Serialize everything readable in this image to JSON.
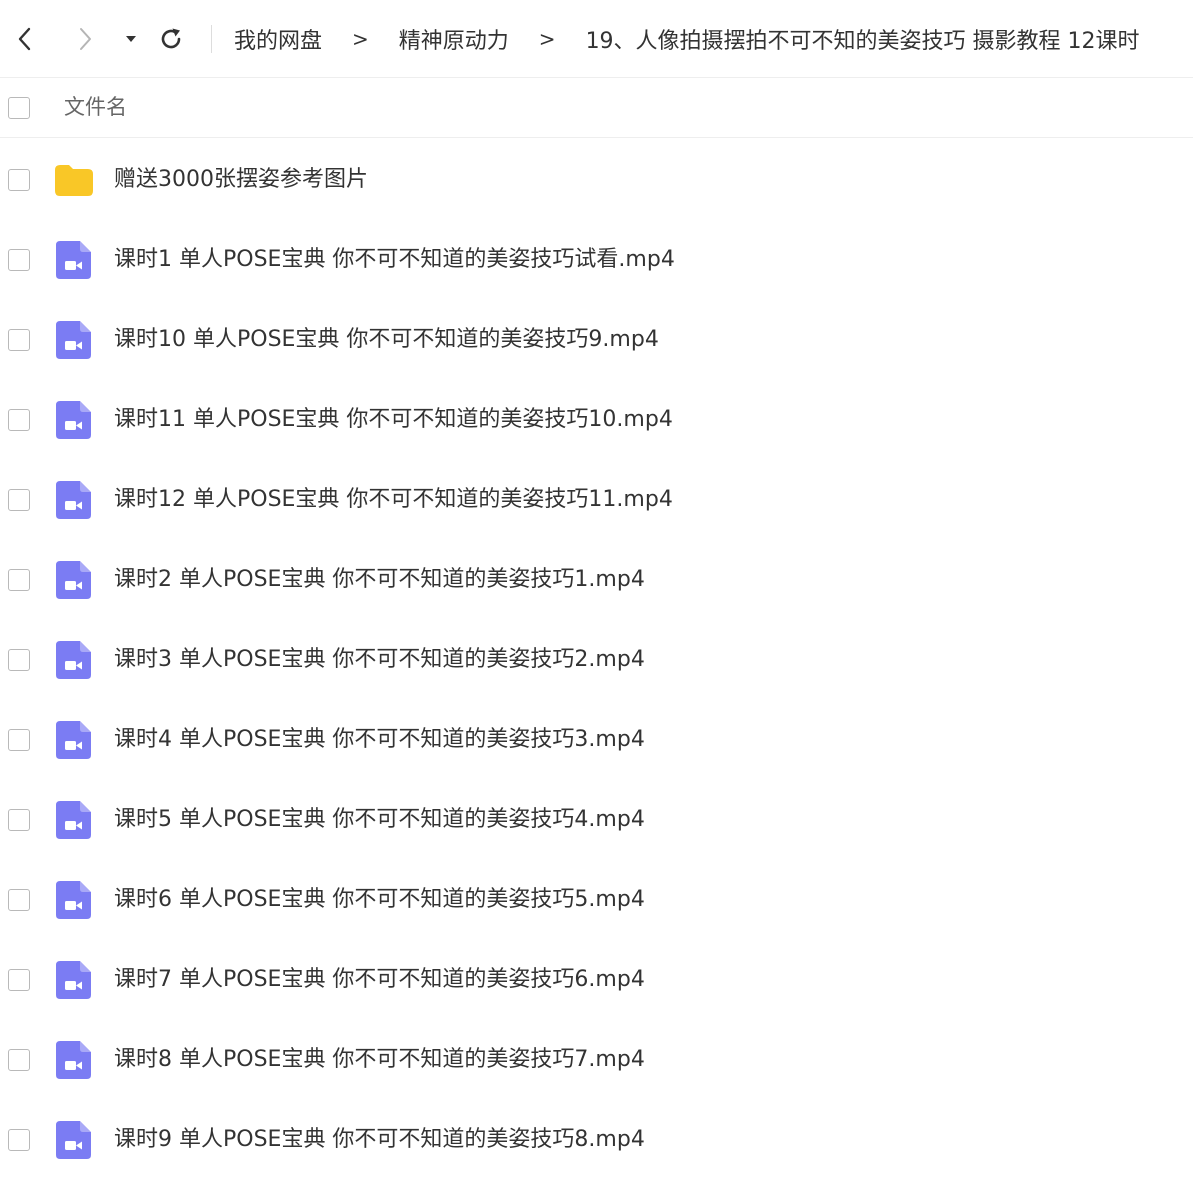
{
  "toolbar": {
    "back_icon": "chevron-left-icon",
    "forward_icon": "chevron-right-icon",
    "dropdown_icon": "caret-down-icon",
    "refresh_icon": "refresh-icon"
  },
  "breadcrumb": {
    "items": [
      "我的网盘",
      "精神原动力",
      "19、人像拍摄摆拍不可不知的美姿技巧 摄影教程 12课时"
    ],
    "separator": ">"
  },
  "header": {
    "column_name": "文件名"
  },
  "colors": {
    "folder": "#F9C727",
    "video": "#7B7CF3",
    "text": "#333333",
    "border": "#EEEEEE"
  },
  "files": [
    {
      "name": "赠送3000张摆姿参考图片",
      "type": "folder"
    },
    {
      "name": "课时1 单人POSE宝典 你不可不知道的美姿技巧试看.mp4",
      "type": "video"
    },
    {
      "name": "课时10 单人POSE宝典 你不可不知道的美姿技巧9.mp4",
      "type": "video"
    },
    {
      "name": "课时11 单人POSE宝典 你不可不知道的美姿技巧10.mp4",
      "type": "video"
    },
    {
      "name": "课时12 单人POSE宝典 你不可不知道的美姿技巧11.mp4",
      "type": "video"
    },
    {
      "name": "课时2 单人POSE宝典 你不可不知道的美姿技巧1.mp4",
      "type": "video"
    },
    {
      "name": "课时3 单人POSE宝典 你不可不知道的美姿技巧2.mp4",
      "type": "video"
    },
    {
      "name": "课时4 单人POSE宝典 你不可不知道的美姿技巧3.mp4",
      "type": "video"
    },
    {
      "name": "课时5 单人POSE宝典 你不可不知道的美姿技巧4.mp4",
      "type": "video"
    },
    {
      "name": "课时6 单人POSE宝典 你不可不知道的美姿技巧5.mp4",
      "type": "video"
    },
    {
      "name": "课时7 单人POSE宝典 你不可不知道的美姿技巧6.mp4",
      "type": "video"
    },
    {
      "name": "课时8 单人POSE宝典 你不可不知道的美姿技巧7.mp4",
      "type": "video"
    },
    {
      "name": "课时9 单人POSE宝典 你不可不知道的美姿技巧8.mp4",
      "type": "video"
    }
  ]
}
